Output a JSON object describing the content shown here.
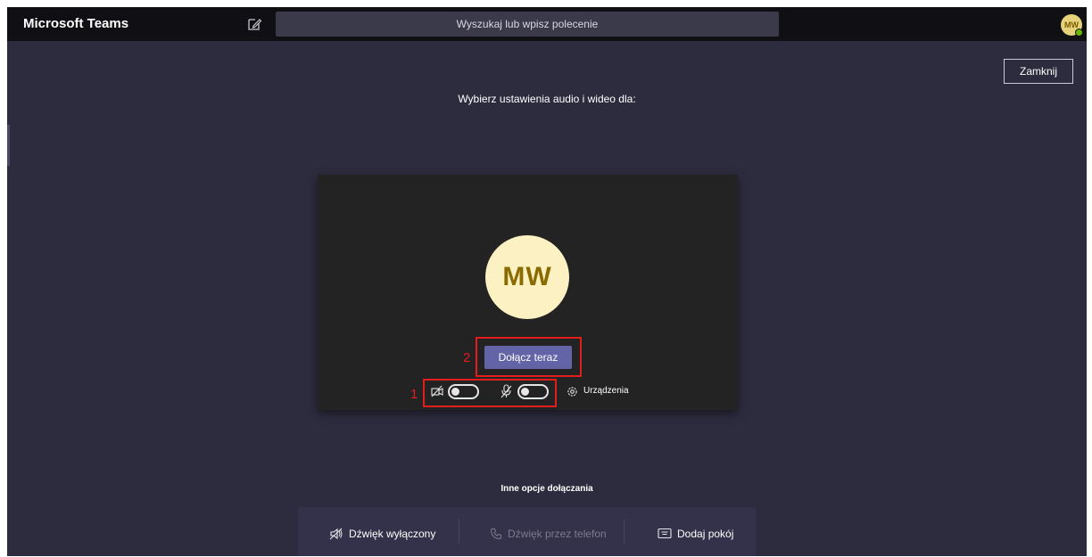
{
  "header": {
    "app_title": "Microsoft Teams",
    "search_placeholder": "Wyszukaj lub wpisz polecenie",
    "user_initials": "MW"
  },
  "page": {
    "close_label": "Zamknij",
    "heading": "Wybierz ustawienia audio i wideo dla:"
  },
  "preview": {
    "avatar_initials": "MW",
    "join_label": "Dołącz teraz",
    "devices_label": "Urządzenia",
    "camera_on": false,
    "mic_on": false
  },
  "annotations": {
    "join_number": "2",
    "toggles_number": "1",
    "color": "#e31c1c"
  },
  "other_options": {
    "heading": "Inne opcje dołączania",
    "items": [
      {
        "label": "Dźwięk wyłączony",
        "icon": "speaker-off-icon"
      },
      {
        "label": "Dźwięk przez telefon",
        "icon": "phone-icon",
        "disabled": true
      },
      {
        "label": "Dodaj pokój",
        "icon": "cast-icon"
      }
    ]
  },
  "colors": {
    "background": "#2d2c3f",
    "titlebar": "#0f0f14",
    "accent": "#6264a7"
  }
}
